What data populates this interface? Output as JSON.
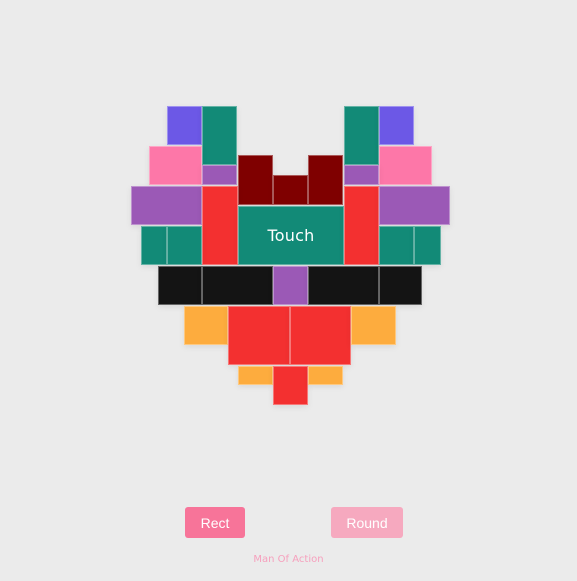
{
  "palette": {
    "teal": "#128a77",
    "blue": "#6c58e6",
    "pink": "#fd77a8",
    "purple": "#9b59b6",
    "maroon": "#7f0000",
    "red": "#f33030",
    "black": "#141414",
    "orange": "#fdac3e"
  },
  "heart": {
    "center_label": "Touch"
  },
  "controls": {
    "rect_label": "Rect",
    "round_label": "Round"
  },
  "footer": {
    "credit": "Man Of Action"
  }
}
